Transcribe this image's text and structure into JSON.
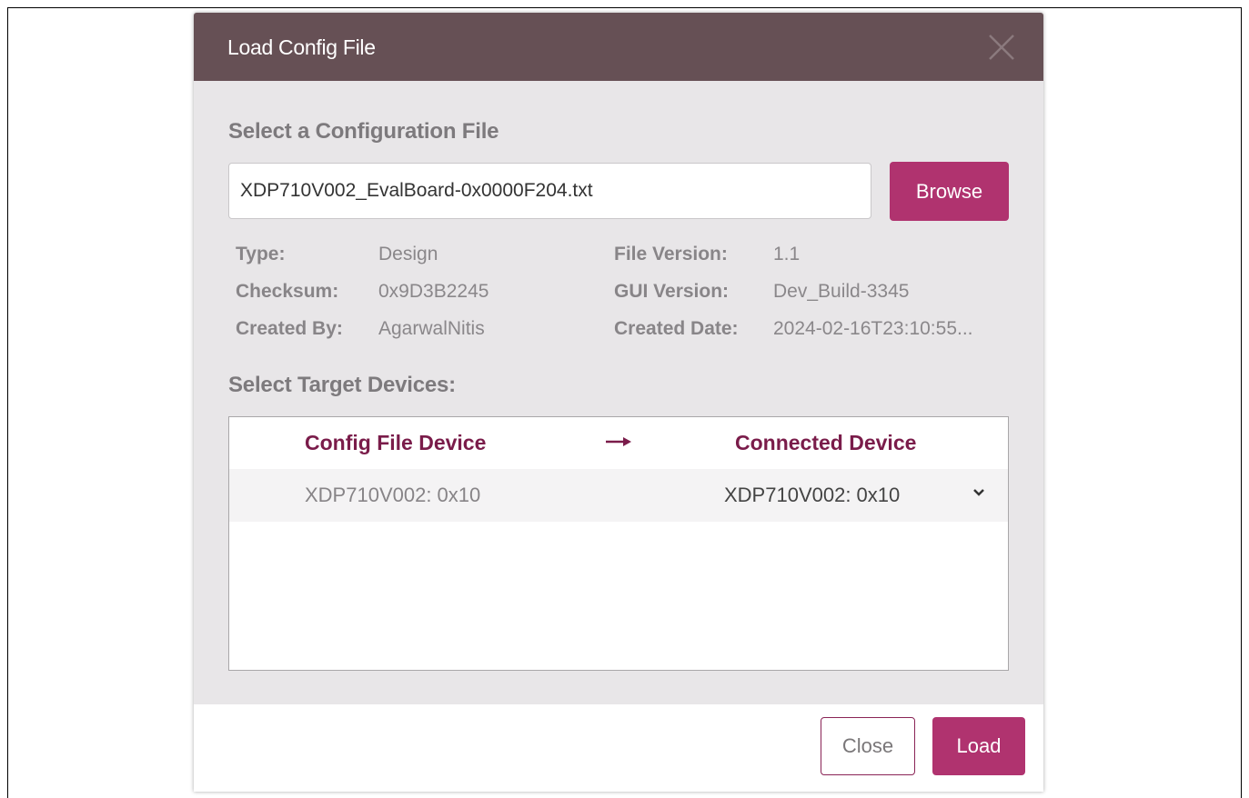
{
  "dialog": {
    "title": "Load Config File",
    "close_icon": "close-icon"
  },
  "file_section": {
    "heading": "Select a Configuration File",
    "file_value": "XDP710V002_EvalBoard-0x0000F204.txt",
    "browse_label": "Browse"
  },
  "file_info": {
    "type_label": "Type:",
    "type_value": "Design",
    "checksum_label": "Checksum:",
    "checksum_value": "0x9D3B2245",
    "created_by_label": "Created By:",
    "created_by_value": "AgarwalNitis",
    "file_version_label": "File Version:",
    "file_version_value": "1.1",
    "gui_version_label": "GUI Version:",
    "gui_version_value": "Dev_Build-3345",
    "created_date_label": "Created Date:",
    "created_date_value": "2024-02-16T23:10:55..."
  },
  "devices": {
    "heading": "Select Target Devices:",
    "col_config": "Config File Device",
    "arrow_icon": "arrow-right-icon",
    "col_connected": "Connected Device",
    "rows": [
      {
        "config_device": "XDP710V002: 0x10",
        "connected_device": "XDP710V002: 0x10"
      }
    ]
  },
  "footer": {
    "close_label": "Close",
    "load_label": "Load"
  },
  "colors": {
    "titlebar": "#665055",
    "accent": "#b0336f",
    "header_text": "#7a1c4a",
    "dialog_bg": "#e8e6e8"
  }
}
